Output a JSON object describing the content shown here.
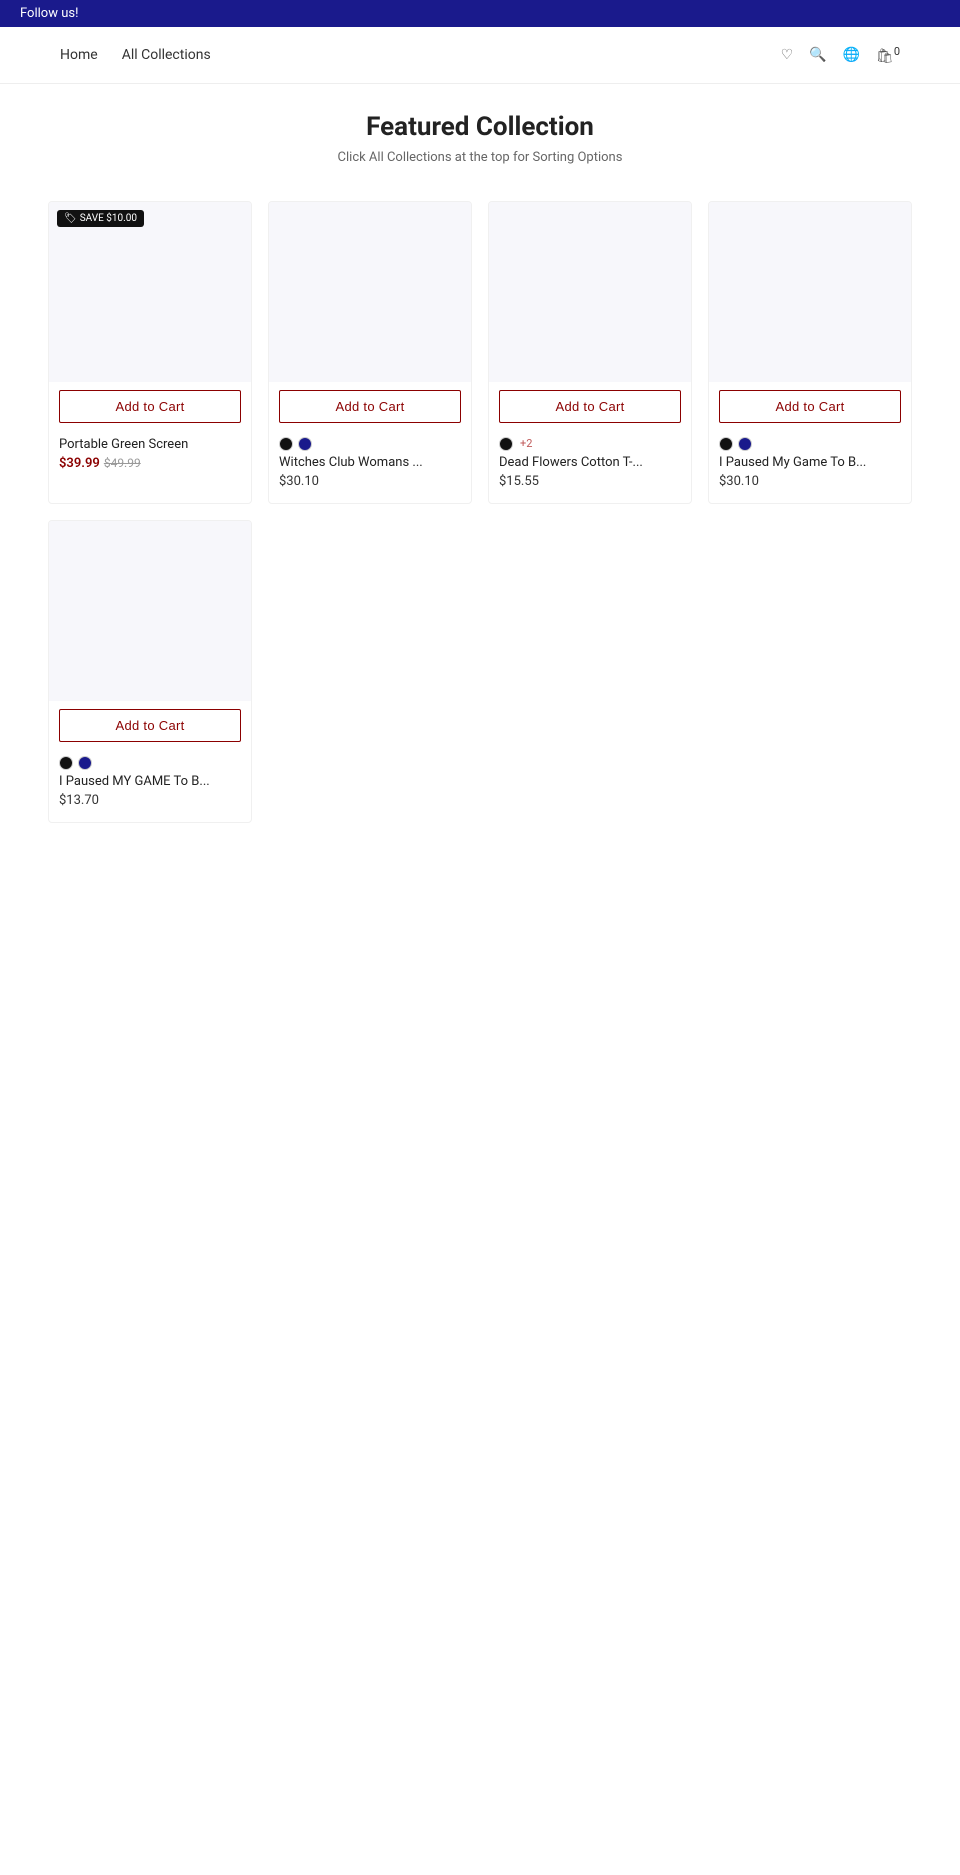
{
  "banner": {
    "text": "Follow us!"
  },
  "nav": {
    "links": [
      {
        "label": "Home",
        "href": "#"
      },
      {
        "label": "All Collections",
        "href": "#"
      }
    ],
    "icons": [
      {
        "name": "favorite_border",
        "label": "favorite_border"
      },
      {
        "name": "search",
        "label": "search"
      },
      {
        "name": "language",
        "label": "language"
      },
      {
        "name": "local_mall",
        "label": "local_mall"
      }
    ],
    "cart_count": "0"
  },
  "page": {
    "title": "Featured Collection",
    "subtitle": "Click All Collections at the top for Sorting Options"
  },
  "products": [
    {
      "id": 1,
      "name": "Portable Green Screen",
      "price_sale": "$39.99",
      "price_original": "$49.99",
      "has_sale_badge": true,
      "sale_badge_text": "local_offer SAVE $10.00",
      "colors": [],
      "add_to_cart_label": "Add to Cart"
    },
    {
      "id": 2,
      "name": "Witches Club Womans ...",
      "price_sale": null,
      "price_original": null,
      "price": "$30.10",
      "has_sale_badge": false,
      "sale_badge_text": "",
      "colors": [
        "#111111",
        "#1a1a8c"
      ],
      "add_to_cart_label": "Add to Cart"
    },
    {
      "id": 3,
      "name": "Dead Flowers Cotton T-...",
      "price_sale": null,
      "price_original": null,
      "price": "$15.55",
      "has_sale_badge": false,
      "sale_badge_text": "",
      "colors": [
        "#111111"
      ],
      "more_colors": "+2",
      "add_to_cart_label": "Add to Cart"
    },
    {
      "id": 4,
      "name": "I Paused My Game To B...",
      "price_sale": null,
      "price_original": null,
      "price": "$30.10",
      "has_sale_badge": false,
      "sale_badge_text": "",
      "colors": [
        "#111111",
        "#1a1a8c"
      ],
      "add_to_cart_label": "Add to Cart"
    },
    {
      "id": 5,
      "name": "I Paused MY GAME To B...",
      "price_sale": null,
      "price_original": null,
      "price": "$13.70",
      "has_sale_badge": false,
      "sale_badge_text": "",
      "colors": [
        "#111111",
        "#1a1a8c"
      ],
      "add_to_cart_label": "Add to Cart"
    }
  ],
  "labels": {
    "add_to_cart": "Add to Cart"
  }
}
